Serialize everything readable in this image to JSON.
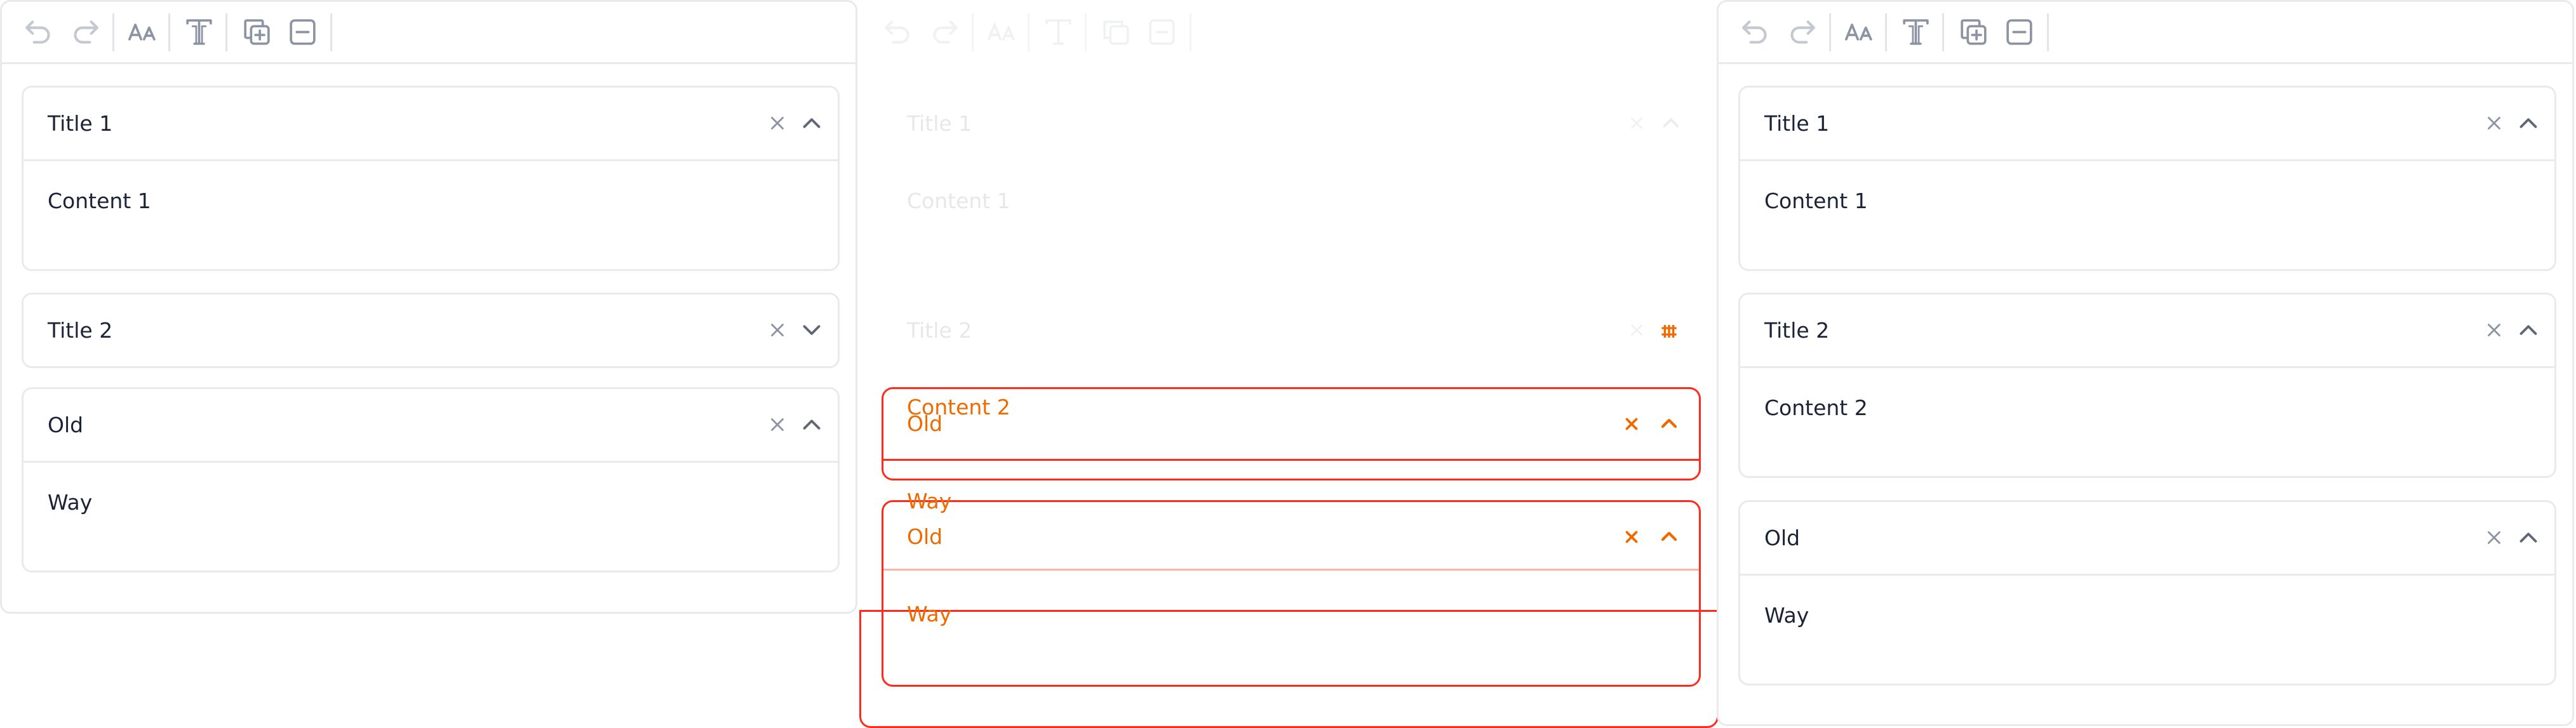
{
  "toolbar": {
    "icons": [
      "undo-icon",
      "redo-icon",
      "font-size-icon",
      "text-format-icon",
      "duplicate-icon",
      "remove-icon"
    ]
  },
  "left": {
    "items": [
      {
        "title": "Title 1",
        "content": "Content 1",
        "expanded": true
      },
      {
        "title": "Title 2",
        "content": "",
        "expanded": false
      },
      {
        "title": "Old",
        "content": "Way",
        "expanded": true
      }
    ]
  },
  "middle": {
    "items": [
      {
        "title": "Title 1",
        "content": "Content 1"
      },
      {
        "title": "Title 2"
      }
    ],
    "overlay": {
      "content2": "Content 2",
      "old1_title": "Old",
      "old1_content": "Way",
      "old2_title": "Old",
      "old2_content": "Way"
    }
  },
  "right": {
    "items": [
      {
        "title": "Title 1",
        "content": "Content 1",
        "expanded": true
      },
      {
        "title": "Title 2",
        "content": "Content 2",
        "expanded": true
      },
      {
        "title": "Old",
        "content": "Way",
        "expanded": true
      }
    ]
  },
  "colors": {
    "accent_red": "#ff2a1a",
    "accent_orange": "#f06a00",
    "border": "#e8eaee",
    "text": "#1b2336",
    "icon": "#8c94a3"
  }
}
